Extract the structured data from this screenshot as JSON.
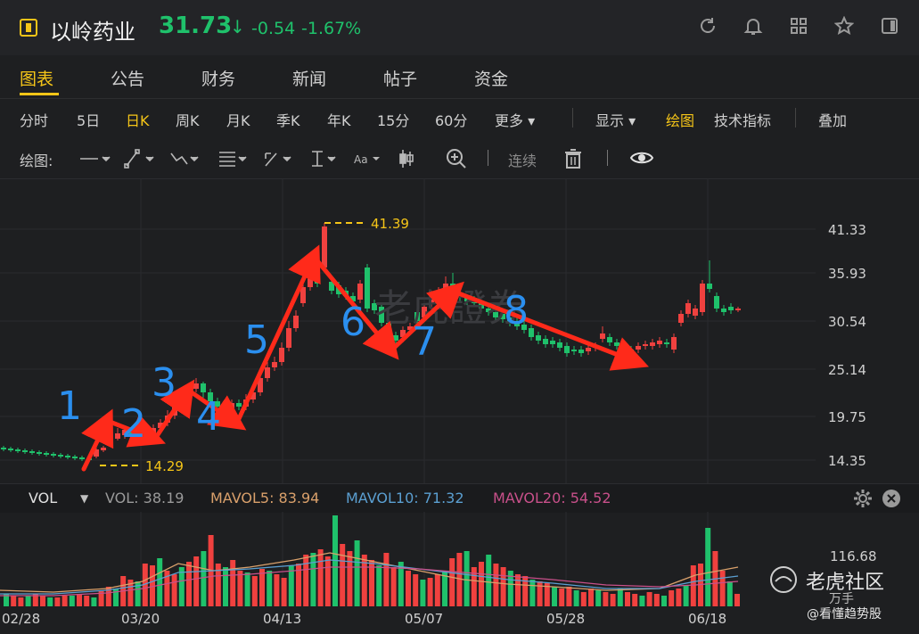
{
  "header": {
    "stock_name": "以岭药业",
    "price": "31.73",
    "arrow": "↓",
    "change": "-0.54",
    "change_pct": "-1.67%",
    "icons": [
      "refresh-icon",
      "bell-icon",
      "grid-icon",
      "star-icon",
      "panel-icon"
    ]
  },
  "tabs": [
    "图表",
    "公告",
    "财务",
    "新闻",
    "帖子",
    "资金"
  ],
  "periods": [
    "分时",
    "5日",
    "日K",
    "周K",
    "月K",
    "季K",
    "年K",
    "15分",
    "60分",
    "更多 ▾",
    "显示 ▾",
    "绘图",
    "技术指标",
    "叠加"
  ],
  "tools": {
    "label": "绘图:",
    "continuous": "连续"
  },
  "price_axis": [
    "41.33",
    "35.93",
    "30.54",
    "25.14",
    "19.75",
    "14.35"
  ],
  "annotations": {
    "high": "41.39",
    "low": "14.29",
    "waves": [
      "1",
      "2",
      "3",
      "4",
      "5",
      "6",
      "7",
      "8"
    ]
  },
  "watermark": "老虎證券",
  "vol_bar": {
    "selector": "VOL",
    "vol": "VOL: 38.19",
    "mavol5": "MAVOL5: 83.94",
    "mavol10": "MAVOL10: 71.32",
    "mavol20": "MAVOL20: 54.52"
  },
  "vol_axis": "116.68",
  "dates": [
    "02/28",
    "03/20",
    "04/13",
    "05/07",
    "05/28",
    "06/18"
  ],
  "brand": {
    "name": "老虎社区",
    "sub": "万手",
    "handle": "@看懂趋势股"
  },
  "colors": {
    "up": "#f0413f",
    "down": "#1fc16b",
    "accent": "#f5c518",
    "arrows": "#ff2a1a",
    "wave_labels": "#2b8fef"
  }
}
